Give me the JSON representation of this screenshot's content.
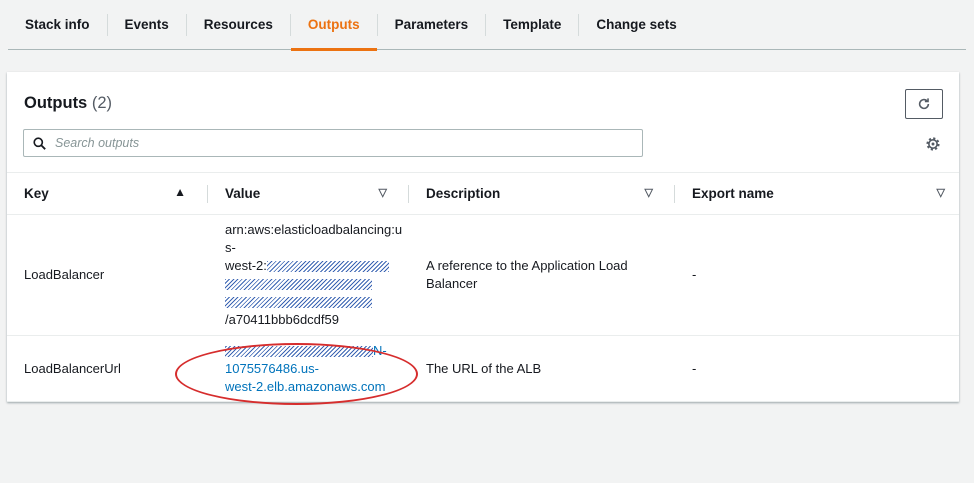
{
  "tabs": [
    {
      "label": "Stack info"
    },
    {
      "label": "Events"
    },
    {
      "label": "Resources"
    },
    {
      "label": "Outputs",
      "active": true
    },
    {
      "label": "Parameters"
    },
    {
      "label": "Template"
    },
    {
      "label": "Change sets"
    }
  ],
  "outputs": {
    "title": "Outputs",
    "count": "(2)",
    "search_placeholder": "Search outputs",
    "columns": {
      "key": "Key",
      "value": "Value",
      "description": "Description",
      "export_name": "Export name"
    },
    "rows": [
      {
        "key": "LoadBalancer",
        "value_line1": "arn:aws:elasticloadbalancing:u",
        "value_line2": "s-",
        "value_line3": "west-2:",
        "value_line4": "/a70411bbb6dcdf59",
        "description_line1": "A reference to the Application Load",
        "description_line2": "Balancer",
        "export_name": "-"
      },
      {
        "key": "LoadBalancerUrl",
        "value_line1": "N-",
        "value_line2": "1075576486.us-",
        "value_line3": "west-2.elb.amazonaws.com",
        "description": "The URL of the ALB",
        "export_name": "-"
      }
    ]
  },
  "icons": {
    "search": "search-icon",
    "refresh": "refresh-icon",
    "settings": "gear-icon"
  },
  "colors": {
    "accent": "#ec7211",
    "link": "#0073bb",
    "annotation": "#d62d2d"
  }
}
